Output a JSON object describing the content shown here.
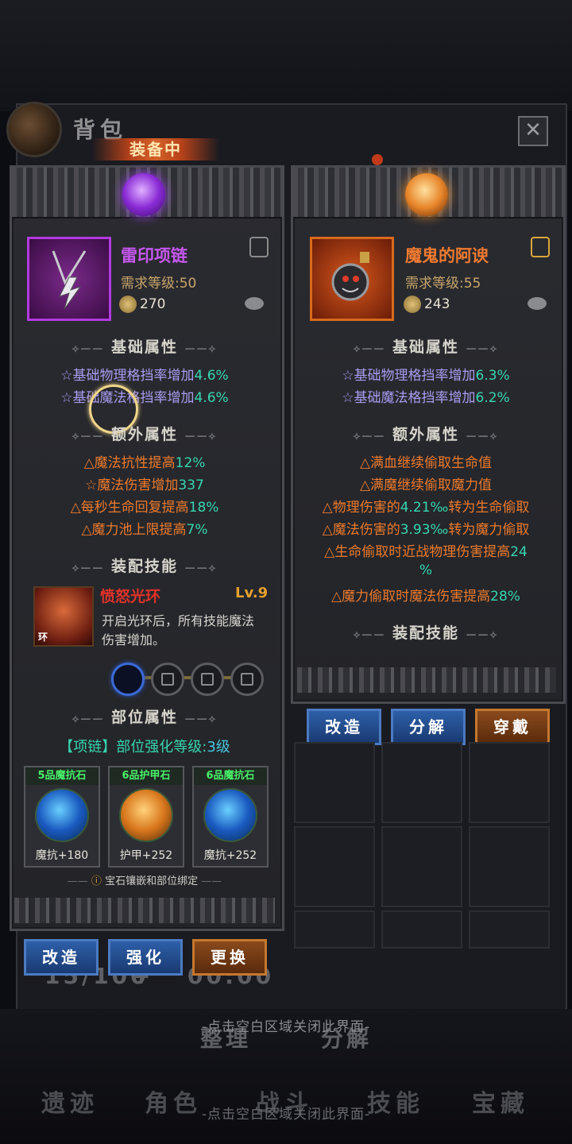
{
  "header": {
    "title": "背包",
    "equipped_tag": "装备中",
    "close": "✕"
  },
  "left": {
    "item": {
      "name": "雷印项链",
      "req": "需求等级:50",
      "score": "270",
      "color": "#b23adf",
      "name_color": "#c658f0"
    },
    "base_title": "基础属性",
    "base": [
      {
        "text": "☆基础物理格挡率增加",
        "val": "4.6%"
      },
      {
        "text": "☆基础魔法格挡率增加",
        "val": "4.6%"
      }
    ],
    "extra_title": "额外属性",
    "extra": [
      {
        "text": "△魔法抗性提高",
        "val": "12%"
      },
      {
        "text": "☆魔法伤害增加",
        "val": "337"
      },
      {
        "text": "△每秒生命回复提高",
        "val": "18%"
      },
      {
        "text": "△魔力池上限提高",
        "val": "7%"
      }
    ],
    "skill_title": "装配技能",
    "skill": {
      "name": "愤怒光环",
      "level": "Lv.9",
      "tag": "环",
      "desc1": "开启光环后，所有技能魔法",
      "desc2": "伤害增加。"
    },
    "part_title": "部位属性",
    "part_text": "【项链】部位强化等级:",
    "part_val": "3级",
    "gems": [
      {
        "head": "5品魔抗石",
        "val": "魔抗+180",
        "color": "blue"
      },
      {
        "head": "6品护甲石",
        "val": "护甲+252",
        "color": "orange"
      },
      {
        "head": "6品魔抗石",
        "val": "魔抗+252",
        "color": "blue"
      }
    ],
    "bind_note": "宝石镶嵌和部位绑定",
    "buttons": [
      "改造",
      "强化",
      "更换"
    ]
  },
  "right": {
    "item": {
      "name": "魔鬼的阿谀",
      "req": "需求等级:55",
      "score": "243",
      "color": "#d86a1c",
      "name_color": "#f07a30"
    },
    "base_title": "基础属性",
    "base": [
      {
        "text": "☆基础物理格挡率增加",
        "val": "6.3%"
      },
      {
        "text": "☆基础魔法格挡率增加",
        "val": "6.2%"
      }
    ],
    "extra_title": "额外属性",
    "extra": [
      {
        "pre": "△满血继续偷取生命值",
        "val": "",
        "post": ""
      },
      {
        "pre": "△满魔继续偷取魔力值",
        "val": "",
        "post": ""
      },
      {
        "pre": "△物理伤害的",
        "val": "4.21‰",
        "post": "转为生命偷取"
      },
      {
        "pre": "△魔法伤害的",
        "val": "3.93‰",
        "post": "转为魔力偷取"
      },
      {
        "pre": "△生命偷取时近战物理伤害提高",
        "val": "24",
        "post": ""
      },
      {
        "pre": "",
        "val": "%",
        "post": ""
      },
      {
        "pre": "△魔力偷取时魔法伤害提高",
        "val": "28%",
        "post": ""
      }
    ],
    "skill_title": "装配技能",
    "buttons": [
      "改造",
      "分解",
      "穿戴"
    ]
  },
  "background": {
    "counter": "15/100",
    "plus": "+",
    "timer": "00:00",
    "sort": "整理",
    "decompose": "分解",
    "nav": [
      "遗迹",
      "角色",
      "战斗",
      "技能",
      "宝藏"
    ]
  },
  "hint": "-点击空白区域关闭此界面-",
  "hint2": "-点击空白区域关闭此界面-"
}
